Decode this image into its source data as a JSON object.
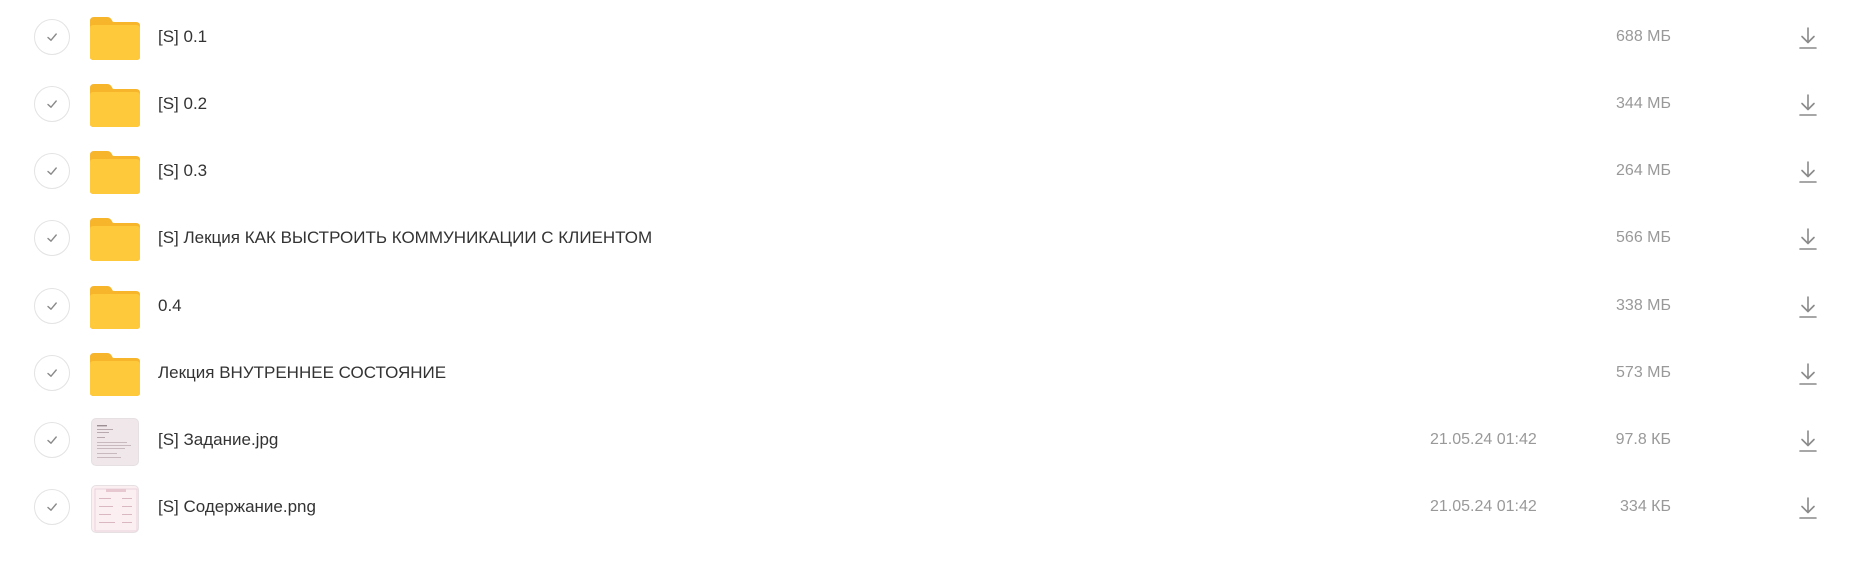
{
  "files": [
    {
      "type": "folder",
      "name": "[S] 0.1",
      "date": "",
      "size": "688 МБ"
    },
    {
      "type": "folder",
      "name": "[S] 0.2",
      "date": "",
      "size": "344 МБ"
    },
    {
      "type": "folder",
      "name": "[S] 0.3",
      "date": "",
      "size": "264 МБ"
    },
    {
      "type": "folder",
      "name": "[S] Лекция КАК ВЫСТРОИТЬ КОММУНИКАЦИИ С КЛИЕНТОМ",
      "date": "",
      "size": "566 МБ"
    },
    {
      "type": "folder",
      "name": "0.4",
      "date": "",
      "size": "338 МБ"
    },
    {
      "type": "folder",
      "name": "Лекция ВНУТРЕННЕЕ СОСТОЯНИЕ",
      "date": "",
      "size": "573 МБ"
    },
    {
      "type": "image",
      "name": "[S] Задание.jpg",
      "date": "21.05.24 01:42",
      "size": "97.8 КБ"
    },
    {
      "type": "image",
      "name": "[S] Содержание.png",
      "date": "21.05.24 01:42",
      "size": "334 КБ"
    }
  ],
  "icons": {
    "select": "checkmark-icon",
    "folder": "folder-icon",
    "image": "image-thumbnail",
    "download": "download-icon"
  },
  "colors": {
    "folder_main": "#FFC93C",
    "folder_back": "#F7B52C",
    "text": "#333333",
    "meta": "#999999"
  }
}
